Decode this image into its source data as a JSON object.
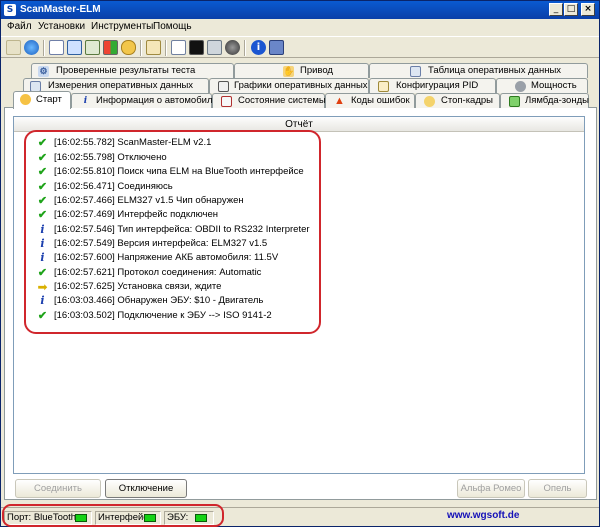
{
  "window": {
    "title": "ScanMaster-ELM"
  },
  "menu": [
    "Файл",
    "Установки",
    "Инструменты",
    "Помощь"
  ],
  "tabs": {
    "row1": [
      {
        "label": "Проверенные результаты теста",
        "icon": "gear-check-icon"
      },
      {
        "label": "Привод",
        "icon": "hand-icon"
      },
      {
        "label": "Таблица оперативных данных",
        "icon": "table-icon"
      }
    ],
    "row2": [
      {
        "label": "Измерения оперативных данных",
        "icon": "gauge-grid-icon"
      },
      {
        "label": "Графики оперативных данных",
        "icon": "graph-icon"
      },
      {
        "label": "Конфигурация PID",
        "icon": "config-icon"
      },
      {
        "label": "Мощность",
        "icon": "power-icon"
      }
    ],
    "row3": [
      {
        "label": "Старт",
        "icon": "start-icon",
        "active": true
      },
      {
        "label": "Информация о автомобиле",
        "icon": "info-icon"
      },
      {
        "label": "Состояние системы",
        "icon": "system-state-icon"
      },
      {
        "label": "Коды ошибок",
        "icon": "warning-icon"
      },
      {
        "label": "Стоп-кадры",
        "icon": "freeze-frame-icon"
      },
      {
        "label": "Лямбда-зонды",
        "icon": "lambda-icon"
      }
    ]
  },
  "report": {
    "header": "Отчёт",
    "rows": [
      {
        "icon": "check",
        "text": "[16:02:55.782] ScanMaster-ELM v2.1"
      },
      {
        "icon": "check",
        "text": "[16:02:55.798] Отключено"
      },
      {
        "icon": "check",
        "text": "[16:02:55.810] Поиск чипа ELM на BlueTooth интерфейсе"
      },
      {
        "icon": "check",
        "text": "[16:02:56.471] Соединяюсь"
      },
      {
        "icon": "check",
        "text": "[16:02:57.466] ELM327 v1.5 Чип обнаружен"
      },
      {
        "icon": "check",
        "text": "[16:02:57.469] Интерфейс подключен"
      },
      {
        "icon": "info",
        "text": "[16:02:57.546] Тип интерфейса: OBDII to RS232 Interpreter"
      },
      {
        "icon": "info",
        "text": "[16:02:57.549] Версия интерфейса: ELM327 v1.5"
      },
      {
        "icon": "info",
        "text": "[16:02:57.600] Напряжение АКБ автомобиля: 11.5V"
      },
      {
        "icon": "check",
        "text": "[16:02:57.621] Протокол соединения: Automatic"
      },
      {
        "icon": "arrow",
        "text": "[16:02:57.625] Установка связи, ждите"
      },
      {
        "icon": "info",
        "text": "[16:03:03.466] Обнаружен ЭБУ: $10 - Двигатель"
      },
      {
        "icon": "check",
        "text": "[16:03:03.502] Подключение к ЭБУ --> ISO 9141-2"
      }
    ]
  },
  "buttons": {
    "connect": "Соединить",
    "disconnect": "Отключение",
    "alpha": "Альфа Ромео",
    "options": "Опель"
  },
  "status": {
    "port": "Порт: BlueTooth",
    "interface": "Интерфейс",
    "ecu": "ЭБУ:",
    "site": "www.wgsoft.de",
    "led_color": "#15d315"
  },
  "colors": {
    "titlebar": "#0a3fa8",
    "check": "#1fa31a",
    "info": "#1b3fae",
    "highlight": "#d0262c"
  }
}
